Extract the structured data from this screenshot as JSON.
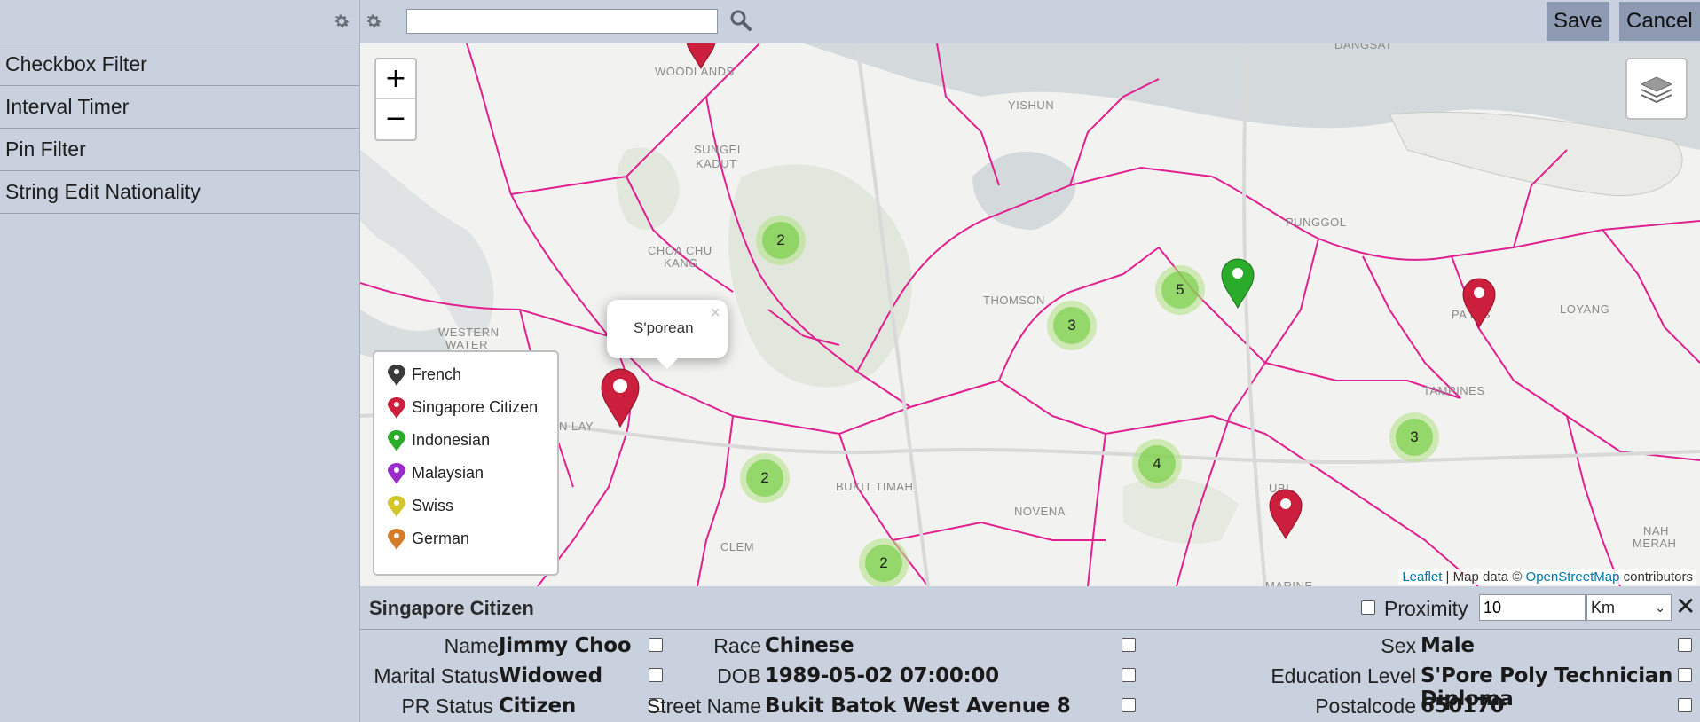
{
  "sidebar": {
    "items": [
      {
        "label": "Checkbox Filter"
      },
      {
        "label": "Interval Timer"
      },
      {
        "label": "Pin Filter"
      },
      {
        "label": "String Edit Nationality"
      }
    ]
  },
  "toolbar": {
    "search_value": "",
    "save_label": "Save",
    "cancel_label": "Cancel"
  },
  "map": {
    "zoom_in": "+",
    "zoom_out": "−",
    "labels": {
      "woodlands": "WOODLANDS",
      "yishun": "YISHUN",
      "sungei": "SUNGEI",
      "kadut": "KADUT",
      "choa1": "CHOA CHU",
      "choa2": "KANG",
      "punggol": "PUNGGOL",
      "thomson": "THOMSON",
      "western1": "WESTERN",
      "western2": "WATER",
      "pasir": "PA    RIS",
      "loyang": "LOYANG",
      "tampines": "TAMPINES",
      "bukit": "BUKIT TIMAH",
      "novena": "NOVENA",
      "clementi": "CLEM",
      "ubi": "UBI",
      "marine": "MARINE",
      "dangsat": "DANGSAT",
      "nah1": "NAH",
      "nah2": "MERAH",
      "lay": "N LAY"
    },
    "clusters": {
      "c1": "2",
      "c2": "3",
      "c3": "5",
      "c4": "2",
      "c5": "4",
      "c6": "3",
      "c7": "2"
    },
    "popup": {
      "text": "S'porean",
      "close": "×"
    },
    "legend": [
      {
        "label": "French",
        "color": "#3a3a3a"
      },
      {
        "label": "Singapore Citizen",
        "color": "#cc1f3e"
      },
      {
        "label": "Indonesian",
        "color": "#2bab2a"
      },
      {
        "label": "Malaysian",
        "color": "#9b2ccc"
      },
      {
        "label": "Swiss",
        "color": "#d2c62a"
      },
      {
        "label": "German",
        "color": "#d37d2a"
      }
    ],
    "attribution": {
      "leaflet": "Leaflet",
      "sep": " | Map data © ",
      "osm": "OpenStreetMap",
      "tail": " contributors"
    }
  },
  "detail": {
    "title": "Singapore Citizen",
    "proximity_label": "Proximity",
    "proximity_value": "10",
    "proximity_unit": "Km",
    "close": "✕",
    "fields": {
      "name_label": "Name",
      "name_value": "Jimmy Choo",
      "race_label": "Race",
      "race_value": "Chinese",
      "sex_label": "Sex",
      "sex_value": "Male",
      "marital_label": "Marital Status",
      "marital_value": "Widowed",
      "dob_label": "DOB",
      "dob_value": "1989-05-02 07:00:00",
      "edu_label": "Education Level",
      "edu_value": "S'Pore Poly Technician Diploma",
      "pr_label": "PR Status",
      "pr_value": "Citizen",
      "street_label": "Street Name",
      "street_value": "Bukit Batok West Avenue 8",
      "postal_label": "Postalcode",
      "postal_value": "650170"
    }
  }
}
